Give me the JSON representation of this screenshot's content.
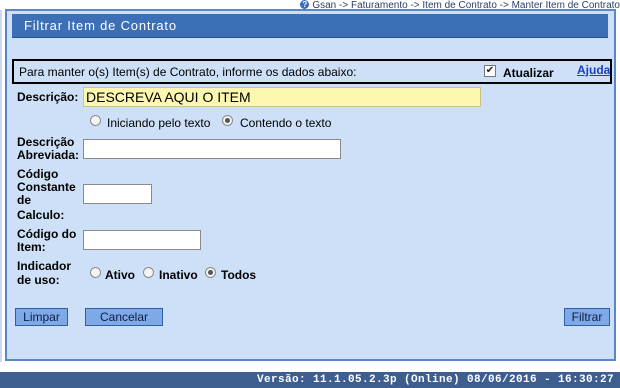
{
  "breadcrumb": "Gsan -> Faturamento -> Item de Contrato -> Manter Item de Contrato",
  "panel": {
    "title": "Filtrar Item de Contrato"
  },
  "info": {
    "text": "Para manter o(s) Item(s) de Contrato, informe os dados abaixo:",
    "update_label": "Atualizar",
    "update_checked": true,
    "help_label": "Ajuda"
  },
  "form": {
    "descricao_label": "Descrição:",
    "descricao_value": "DESCREVA AQUI O ITEM",
    "match_options": [
      {
        "label": "Iniciando pelo texto",
        "checked": false
      },
      {
        "label": "Contendo o texto",
        "checked": true
      }
    ],
    "descricao_abreviada_label_1": "Descrição",
    "descricao_abreviada_label_2": "Abreviada:",
    "descricao_abreviada_value": "",
    "codigo_constante_label_1": "Código",
    "codigo_constante_label_2": "Constante",
    "codigo_constante_label_3": "de",
    "codigo_constante_label_4": "Calculo:",
    "codigo_constante_value": "",
    "codigo_item_label_1": "Código do",
    "codigo_item_label_2": "Item:",
    "codigo_item_value": "",
    "indicador_label_1": "Indicador",
    "indicador_label_2": "de uso:",
    "indicador_options": [
      {
        "label": "Ativo",
        "checked": false
      },
      {
        "label": "Inativo",
        "checked": false
      },
      {
        "label": "Todos",
        "checked": true
      }
    ]
  },
  "buttons": {
    "limpar": "Limpar",
    "cancelar": "Cancelar",
    "filtrar": "Filtrar"
  },
  "footer": "Versão: 11.1.05.2.3p (Online) 08/06/2016 - 16:30:27"
}
